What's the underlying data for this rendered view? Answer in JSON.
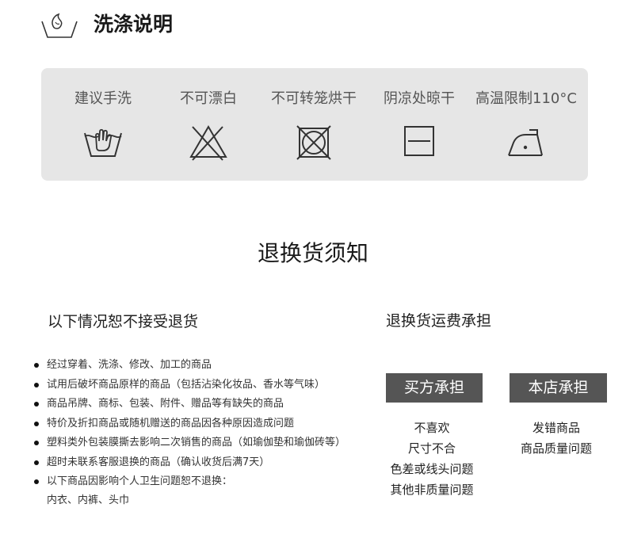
{
  "wash": {
    "icon": "wash-basin-icon",
    "title": "洗涤说明"
  },
  "care": [
    {
      "label": "建议手洗",
      "icon": "hand-wash-icon"
    },
    {
      "label": "不可漂白",
      "icon": "no-bleach-icon"
    },
    {
      "label": "不可转笼烘干",
      "icon": "no-tumble-dry-icon"
    },
    {
      "label": "阴凉处晾干",
      "icon": "dry-in-shade-icon"
    },
    {
      "label": "高温限制110°C",
      "icon": "iron-low-heat-icon"
    }
  ],
  "returns": {
    "title": "退换货须知",
    "left_heading": "以下情况恕不接受退货",
    "rules": [
      "经过穿着、洗涤、修改、加工的商品",
      "试用后破坏商品原样的商品（包括沾染化妆品、香水等气味）",
      "商品吊牌、商标、包装、附件、赠品等有缺失的商品",
      "特价及折扣商品或随机赠送的商品因各种原因造成问题",
      "塑料类外包装膜撕去影响二次销售的商品（如瑜伽垫和瑜伽砖等）",
      "超时未联系客服退换的商品（确认收货后满7天）",
      "以下商品因影响个人卫生问题恕不退换："
    ],
    "rules_extra": "内衣、内裤、头巾",
    "right_heading": "退换货运费承担",
    "buyer": {
      "label": "买方承担",
      "reasons": [
        "不喜欢",
        "尺寸不合",
        "色差或线头问题",
        "其他非质量问题"
      ]
    },
    "store": {
      "label": "本店承担",
      "reasons": [
        "发错商品",
        "商品质量问题"
      ]
    }
  }
}
